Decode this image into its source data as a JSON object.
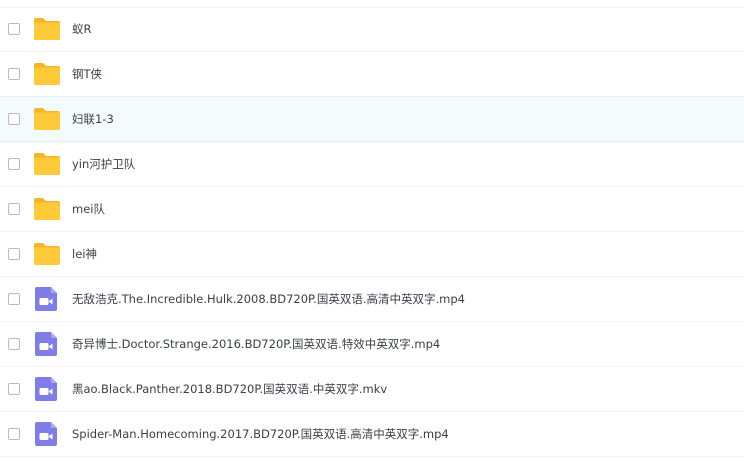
{
  "files": [
    {
      "name": "蚁R",
      "type": "folder"
    },
    {
      "name": "钢T侠",
      "type": "folder"
    },
    {
      "name": "妇联1-3",
      "type": "folder",
      "highlighted": true
    },
    {
      "name": "yin河护卫队",
      "type": "folder"
    },
    {
      "name": "mei队",
      "type": "folder"
    },
    {
      "name": "lei神",
      "type": "folder"
    },
    {
      "name": "无敌浩克.The.Incredible.Hulk.2008.BD720P.国英双语.高清中英双字.mp4",
      "type": "video"
    },
    {
      "name": "奇异博士.Doctor.Strange.2016.BD720P.国英双语.特效中英双字.mp4",
      "type": "video"
    },
    {
      "name": "黑ao.Black.Panther.2018.BD720P.国英双语.中英双字.mkv",
      "type": "video"
    },
    {
      "name": "Spider-Man.Homecoming.2017.BD720P.国英双语.高清中英双字.mp4",
      "type": "video"
    }
  ],
  "colors": {
    "folder": "#ffca3a",
    "folder_tab": "#f5b625",
    "video": "#7f7ee8"
  },
  "icons": {
    "folder": "folder-icon",
    "video": "video-file-icon"
  }
}
